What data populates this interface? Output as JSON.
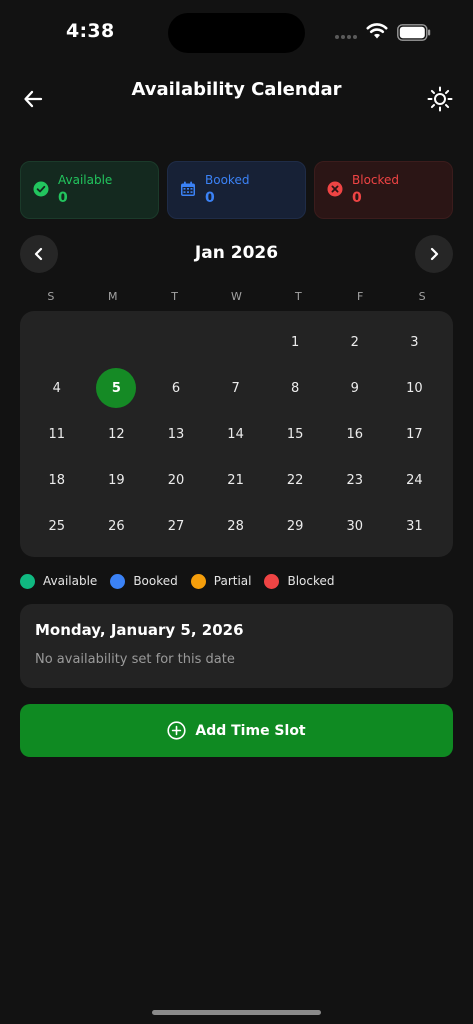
{
  "status_bar": {
    "time": "4:38"
  },
  "header": {
    "title": "Availability Calendar"
  },
  "summary": {
    "available": {
      "label": "Available",
      "count": "0",
      "color": "#22c55e"
    },
    "booked": {
      "label": "Booked",
      "count": "0",
      "color": "#3b82f6"
    },
    "blocked": {
      "label": "Blocked",
      "count": "0",
      "color": "#ef4444"
    }
  },
  "calendar": {
    "month_label": "Jan 2026",
    "weekdays": [
      "S",
      "M",
      "T",
      "W",
      "T",
      "F",
      "S"
    ],
    "leading_blanks": 4,
    "days": [
      "1",
      "2",
      "3",
      "4",
      "5",
      "6",
      "7",
      "8",
      "9",
      "10",
      "11",
      "12",
      "13",
      "14",
      "15",
      "16",
      "17",
      "18",
      "19",
      "20",
      "21",
      "22",
      "23",
      "24",
      "25",
      "26",
      "27",
      "28",
      "29",
      "30",
      "31"
    ],
    "selected_day": "5",
    "selected_color": "#158a25"
  },
  "legend": [
    {
      "label": "Available",
      "color": "#10b981"
    },
    {
      "label": "Booked",
      "color": "#3b82f6"
    },
    {
      "label": "Partial",
      "color": "#f59e0b"
    },
    {
      "label": "Blocked",
      "color": "#ef4444"
    }
  ],
  "details": {
    "date_title": "Monday, January 5, 2026",
    "empty_message": "No availability set for this date"
  },
  "actions": {
    "add_label": "Add Time Slot"
  },
  "icons": {
    "back": "arrow-left-icon",
    "theme": "sun-icon",
    "prev": "chevron-left-icon",
    "next": "chevron-right-icon",
    "available": "check-circle-icon",
    "booked": "calendar-icon",
    "blocked": "x-circle-icon",
    "add": "plus-circle-icon"
  }
}
